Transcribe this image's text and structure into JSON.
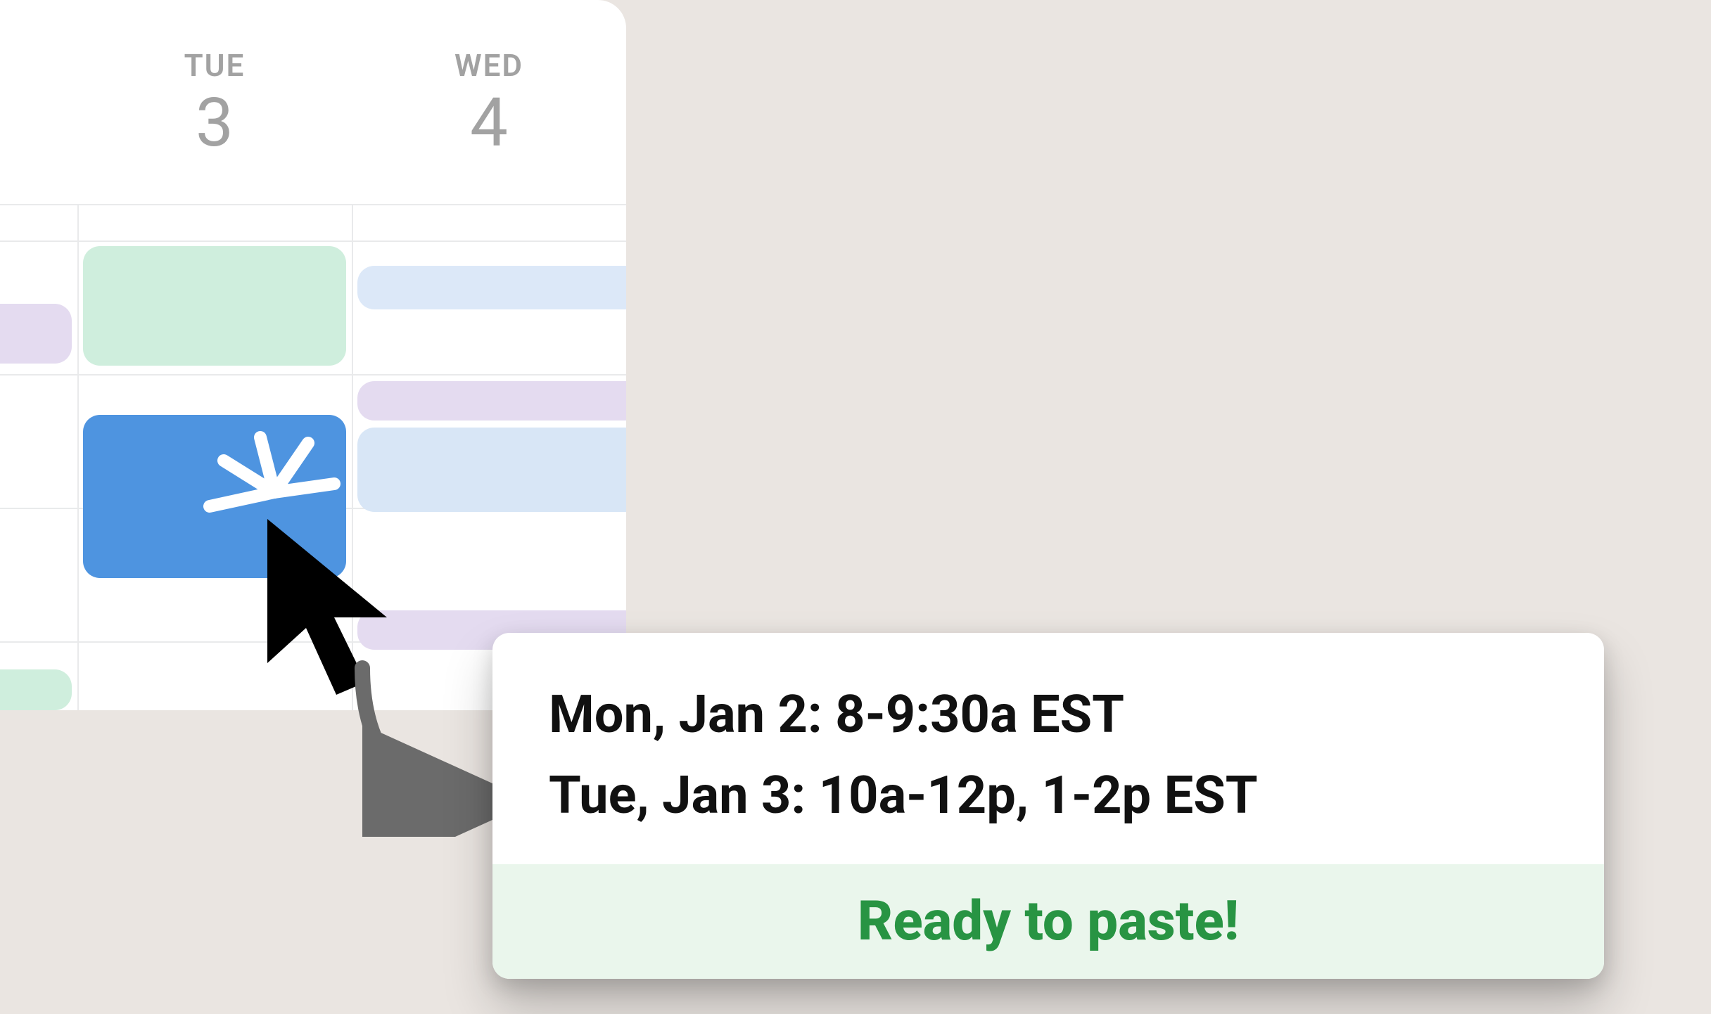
{
  "calendar": {
    "days": [
      {
        "label": "TUE",
        "number": "3"
      },
      {
        "label": "WED",
        "number": "4"
      }
    ]
  },
  "result": {
    "line1": "Mon, Jan 2: 8-9:30a EST",
    "line2": "Tue, Jan 3: 10a-12p, 1-2p EST",
    "status": "Ready to paste!"
  },
  "colors": {
    "bg": "#EAE5E1",
    "accent_blue": "#4E94E0",
    "status_green": "#289443"
  }
}
